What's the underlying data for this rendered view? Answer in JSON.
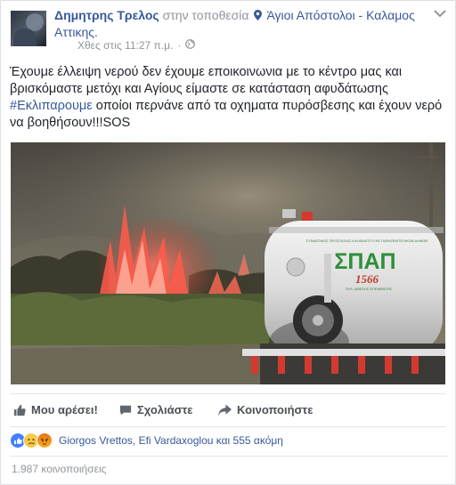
{
  "post": {
    "author": "Δημητρης Τρελος",
    "at_location": "στην τοποθεσία",
    "location": "Άγιοι Απόστολοι - Καλαμος Αττικης.",
    "timestamp": "Χθες στις 11:27 π.μ.",
    "separator": "·",
    "text_line1": "Έχουμε έλλειψη νερού δεν έχουμε εποικοινωνια με το κέντρο μας και",
    "text_line2": "βρισκόμαστε μετόχι και Αγίους είμαστε σε κατάσταση αφυδάτωσης",
    "hashtag": "#Εκλιπαρουμε",
    "text_line3_rest": " οποίοι περνάνε από τα οχηματα πυρόσβεσης και έχουν νερό",
    "text_line4": "να βοηθήσουν!!!SOS"
  },
  "photo": {
    "truck_brand": "ΣΠΑΠ",
    "truck_number": "1566",
    "truck_top_text": "ΣΥΝΔΕΣΜΟΣ ΠΡΟΣΤΑΣΙΑΣ ΚΑΙ ΑΝΑΠΤΥΞΗΣ ΠΑΡΑΠΕΝΤΕΛΙΚΩΝ ΔΗΜΩΝ",
    "truck_bottom_text": "ΤΗΛ. ΑΜΕΣΗΣ ΕΠΕΜΒΑΣΗΣ"
  },
  "actions": {
    "like": "Μου αρέσει!",
    "comment": "Σχολιάστε",
    "share": "Κοινοποιήστε"
  },
  "reactions": {
    "types": [
      "like-icon",
      "sad-icon",
      "angry-icon"
    ],
    "names": "Giorgos Vrettos, Efi Vardaxoglou και 555 ακόμη"
  },
  "shares": {
    "count": "1.987 κοινοποιήσεις"
  },
  "colors": {
    "link": "#365899",
    "meta": "#90949c",
    "text": "#1d2129",
    "action": "#4b4f56",
    "like_blue": "#4080ff"
  }
}
